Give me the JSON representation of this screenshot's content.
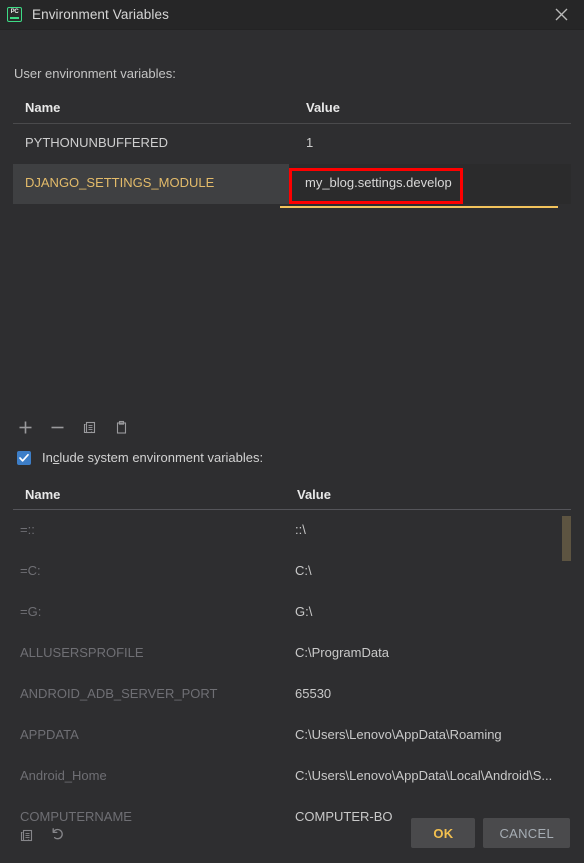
{
  "window": {
    "title": "Environment Variables",
    "app_icon": "pycharm-icon",
    "app_icon_text": "PC",
    "close_icon": "close-icon"
  },
  "user_section": {
    "label": "User environment variables:",
    "columns": [
      "Name",
      "Value"
    ],
    "rows": [
      {
        "name": "PYTHONUNBUFFERED",
        "value": "1",
        "selected": false
      },
      {
        "name": "DJANGO_SETTINGS_MODULE",
        "value": "my_blog.settings.develop",
        "selected": true,
        "editing": true
      }
    ],
    "editing_value": "my_blog.settings.develop"
  },
  "toolbar": {
    "add_label": "+",
    "remove_label": "−",
    "copy_label": "copy-icon",
    "paste_label": "paste-icon"
  },
  "include_system": {
    "label_prefix": "In",
    "label_mnemonic": "c",
    "label_suffix": "lude system environment variables:",
    "checked": true
  },
  "system_section": {
    "columns": [
      "Name",
      "Value"
    ],
    "rows": [
      {
        "name": "=::",
        "value": "::\\"
      },
      {
        "name": "=C:",
        "value": "C:\\"
      },
      {
        "name": "=G:",
        "value": "G:\\"
      },
      {
        "name": "ALLUSERSPROFILE",
        "value": "C:\\ProgramData"
      },
      {
        "name": "ANDROID_ADB_SERVER_PORT",
        "value": "65530"
      },
      {
        "name": "APPDATA",
        "value": "C:\\Users\\Lenovo\\AppData\\Roaming"
      },
      {
        "name": "Android_Home",
        "value": "C:\\Users\\Lenovo\\AppData\\Local\\Android\\S..."
      },
      {
        "name": "COMPUTERNAME",
        "value": "COMPUTER-BO"
      }
    ]
  },
  "bottom_icons": {
    "copy": "copy-icon",
    "revert": "revert-icon"
  },
  "footer": {
    "ok_label": "OK",
    "cancel_label": "CANCEL"
  },
  "colors": {
    "dialog_bg": "#2e2e30",
    "titlebar_bg": "#262627",
    "selected_row_bg": "#3f4042",
    "selected_row_text": "#e3bb6a",
    "annotation_red": "#fe0000",
    "edit_underline": "#f2c35c",
    "checkbox_blue": "#3d7ec7",
    "scrollbar_thumb": "#5d5441",
    "ok_text": "#f3c04f",
    "cancel_text": "#a6adb4",
    "app_icon_green": "#3ddb85"
  }
}
